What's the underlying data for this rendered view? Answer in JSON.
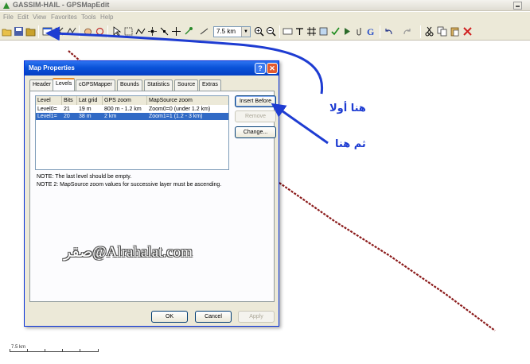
{
  "window": {
    "title": "GASSIM-HAIL - GPSMapEdit"
  },
  "menu": [
    "File",
    "Edit",
    "View",
    "Favorites",
    "Tools",
    "Help"
  ],
  "toolbar": {
    "zoom_value": "7.5 km",
    "icons": [
      "open-icon",
      "save-icon",
      "folder-icon",
      "map-properties-icon",
      "select-icon",
      "zoom-in-icon",
      "zoom-out-icon",
      "undo-icon",
      "redo-icon",
      "cut-icon",
      "copy-icon",
      "paste-icon",
      "delete-icon"
    ]
  },
  "dialog": {
    "title": "Map Properties",
    "tabs": [
      "Header",
      "Levels",
      "cGPSMapper",
      "Bounds",
      "Statistics",
      "Source",
      "Extras"
    ],
    "active_tab": "Levels",
    "table": {
      "columns": [
        "Level",
        "Bits",
        "Lat grid",
        "GPS zoom",
        "MapSource zoom"
      ],
      "rows": [
        {
          "level": "Level0=",
          "bits": "21",
          "lat_grid": "19 m",
          "gps_zoom": "800 m - 1.2 km",
          "mapsource_zoom": "Zoom0=0 (under 1.2 km)"
        },
        {
          "level": "Level1=",
          "bits": "20",
          "lat_grid": "38 m",
          "gps_zoom": "2 km",
          "mapsource_zoom": "Zoom1=1 (1.2 - 3 km)"
        }
      ],
      "selected_row": 1
    },
    "buttons": {
      "insert_before": "Insert Before",
      "remove": "Remove",
      "change": "Change...",
      "ok": "OK",
      "cancel": "Cancel",
      "apply": "Apply"
    },
    "notes": [
      "NOTE: The last level should be empty.",
      "NOTE 2: MapSource zoom values for successive layer must be ascending."
    ]
  },
  "annotations": {
    "first_here": "هنا أولا",
    "then_here": "ثم هنا",
    "arrow_color": "#1e3cd2"
  },
  "watermark": "صقر@Alrahalat.com",
  "scale": {
    "label": "7.5 km"
  },
  "colors": {
    "track": "#8b1a1a",
    "dialog_title": "#0a52d8",
    "selected_row": "#316ac5"
  }
}
